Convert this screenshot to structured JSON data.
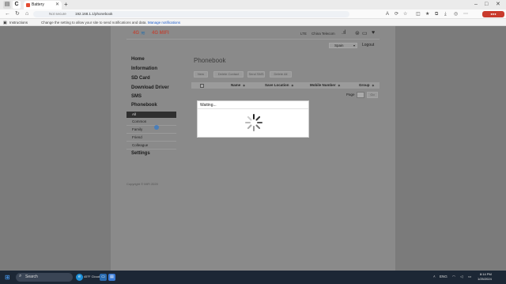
{
  "browser": {
    "tab_title": "Battery",
    "url_notsecure": "Not secure",
    "url": "192.168.1.1/phonebook",
    "infobar_title": "Instructions",
    "infobar_text": "Change the setting to allow your site to send notifications and data.",
    "infobar_link": "Manage notifications"
  },
  "router": {
    "logo_left": "4G",
    "logo_text": "4G MIFI",
    "status_net": "LTE",
    "status_carrier": "China Telecom",
    "lang_select": "Spain",
    "logout": "Logout",
    "menu": [
      "Home",
      "Information",
      "SD Card",
      "Download Driver",
      "SMS",
      "Phonebook",
      "Settings"
    ],
    "phonebook_sub": [
      "All",
      "Common",
      "Family",
      "Friend",
      "Colleague"
    ],
    "copyright": "Copyright © MiFi 2020"
  },
  "phonebook": {
    "title": "Phonebook",
    "buttons": [
      "New",
      "Delete Contact",
      "Send SMS",
      "Delete All"
    ],
    "columns": [
      "Name",
      "Save Location",
      "Mobile Number",
      "Group"
    ],
    "page_label": "Page",
    "go_label": "Go"
  },
  "modal": {
    "title": "Waiting..."
  },
  "taskbar": {
    "search": "Search",
    "weather": "45°F Cloudy",
    "tray_lang": "ENG",
    "time": "8:14 PM",
    "date": "1/25/2024"
  },
  "colors": {
    "overlay": "#7b7b7b",
    "accent_red": "#b94a3c",
    "menu_active": "#2f2f2f"
  }
}
